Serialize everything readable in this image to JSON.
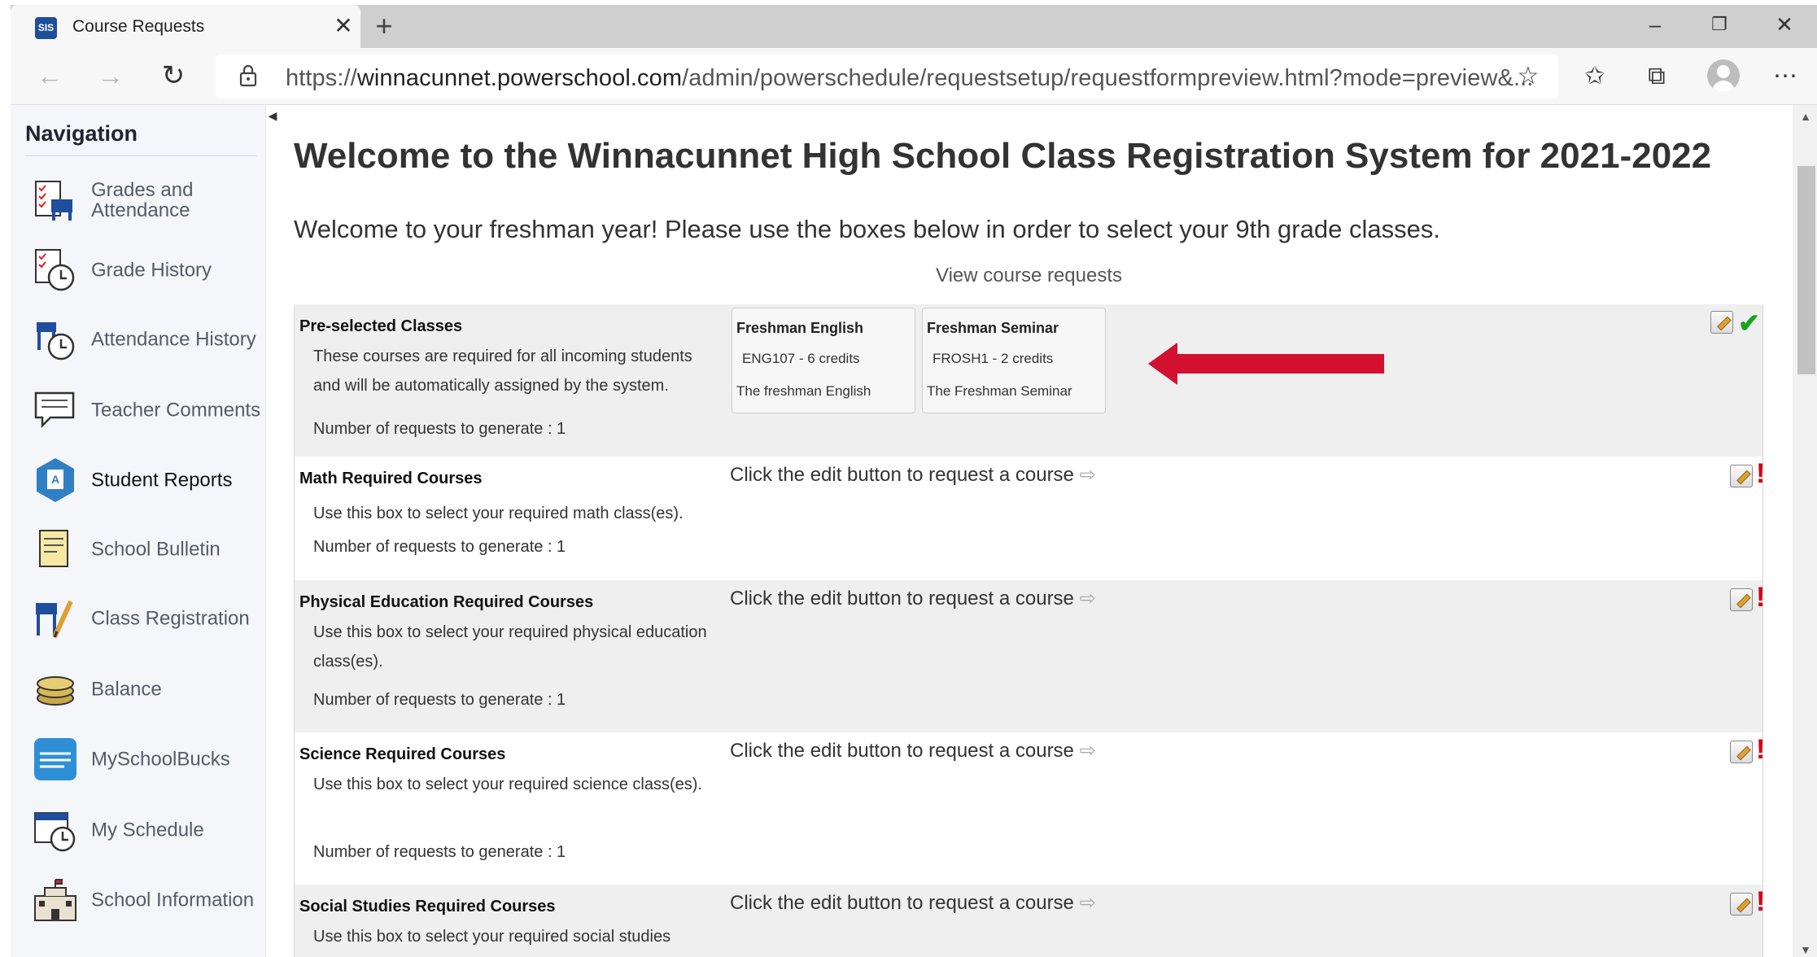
{
  "browser": {
    "tab_title": "Course Requests",
    "favicon_text": "SIS",
    "url_scheme": "https://",
    "url_host": "winnacunnet.powerschool.com",
    "url_path": "/admin/powerschedule/requestsetup/requestformpreview.html?mode=preview&..."
  },
  "sidebar": {
    "heading": "Navigation",
    "items": [
      {
        "label": "Grades and Attendance",
        "icon": "grades-attendance-icon"
      },
      {
        "label": "Grade History",
        "icon": "grade-history-icon"
      },
      {
        "label": "Attendance History",
        "icon": "attendance-history-icon"
      },
      {
        "label": "Teacher Comments",
        "icon": "teacher-comments-icon"
      },
      {
        "label": "Student Reports",
        "icon": "student-reports-icon"
      },
      {
        "label": "School Bulletin",
        "icon": "school-bulletin-icon"
      },
      {
        "label": "Class Registration",
        "icon": "class-registration-icon"
      },
      {
        "label": "Balance",
        "icon": "balance-icon"
      },
      {
        "label": "MySchoolBucks",
        "icon": "myschoolbucks-icon"
      },
      {
        "label": "My Schedule",
        "icon": "my-schedule-icon"
      },
      {
        "label": "School Information",
        "icon": "school-information-icon"
      }
    ]
  },
  "main": {
    "title": "Welcome to the Winnacunnet High School Class Registration System for 2021-2022",
    "welcome": "Welcome to your freshman year! Please use the boxes below in order to select your 9th grade classes.",
    "view_link": "View course requests",
    "sections": [
      {
        "title": "Pre-selected Classes",
        "desc": "These courses are required for all incoming students and will be automatically assigned by the system.",
        "num": "Number of requests to generate : 1",
        "status": "complete",
        "courses": [
          {
            "name": "Freshman English",
            "code": "ENG107 - 6 credits",
            "desc": "The freshman English"
          },
          {
            "name": "Freshman Seminar",
            "code": "FROSH1 - 2 credits",
            "desc": "The Freshman Seminar"
          }
        ]
      },
      {
        "title": "Math Required Courses",
        "desc": "Use this box to select your required math class(es).",
        "num": "Number of requests to generate : 1",
        "prompt": "Click the edit button to request a course",
        "status": "incomplete"
      },
      {
        "title": "Physical Education Required Courses",
        "desc": "Use this box to select your required physical education class(es).",
        "num": "Number of requests to generate : 1",
        "prompt": "Click the edit button to request a course",
        "status": "incomplete"
      },
      {
        "title": "Science Required Courses",
        "desc": "Use this box to select your required science class(es).",
        "num": "Number of requests to generate : 1",
        "prompt": "Click the edit button to request a course",
        "status": "incomplete"
      },
      {
        "title": "Social Studies Required Courses",
        "desc": "Use this box to select your required social studies",
        "prompt": "Click the edit button to request a course",
        "status": "incomplete"
      }
    ],
    "prompt_arrow": "⇨",
    "ok_mark": "✔",
    "bang_mark": "!"
  },
  "colors": {
    "accent_red": "#d4102f",
    "check_green": "#1ca21c"
  }
}
